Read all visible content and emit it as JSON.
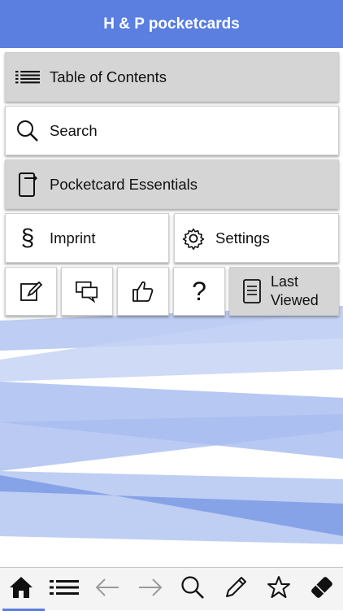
{
  "app": {
    "title": "H & P pocketcards"
  },
  "menu": {
    "toc_label": "Table of Contents",
    "search_label": "Search",
    "essentials_label": "Pocketcard Essentials",
    "imprint_label": "Imprint",
    "settings_label": "Settings",
    "last_viewed_line1": "Last",
    "last_viewed_line2": "Viewed"
  },
  "small_buttons": [
    {
      "icon": "edit-note-icon"
    },
    {
      "icon": "chat-bubbles-icon"
    },
    {
      "icon": "thumbs-up-icon"
    },
    {
      "icon": "question-icon"
    }
  ],
  "tabbar": {
    "active_tab": "home",
    "tabs": [
      "home-icon",
      "list-icon",
      "back-arrow-icon",
      "forward-arrow-icon",
      "search-icon",
      "pencil-icon",
      "star-icon",
      "eraser-icon"
    ]
  },
  "colors": {
    "accent": "#5a7fe0",
    "tile_gray": "#d5d5d5",
    "stripes": "#7f9de6"
  }
}
